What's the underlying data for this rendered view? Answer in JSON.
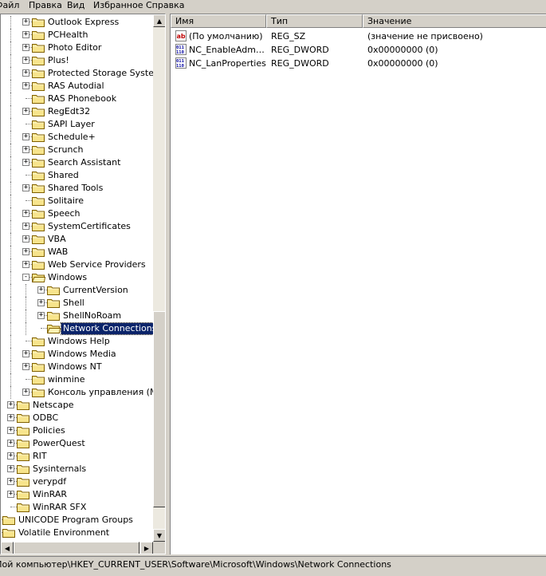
{
  "menu": {
    "items": [
      "Файл",
      "Правка",
      "Вид",
      "Избранное",
      "Справка"
    ]
  },
  "tree": {
    "items": [
      {
        "label": "Outlook Express",
        "expander": "+",
        "level": 2
      },
      {
        "label": "PCHealth",
        "expander": "+",
        "level": 2
      },
      {
        "label": "Photo Editor",
        "expander": "+",
        "level": 2
      },
      {
        "label": "Plus!",
        "expander": "+",
        "level": 2
      },
      {
        "label": "Protected Storage System Provider",
        "expander": "+",
        "level": 2
      },
      {
        "label": "RAS Autodial",
        "expander": "+",
        "level": 2
      },
      {
        "label": "RAS Phonebook",
        "expander": "",
        "level": 2
      },
      {
        "label": "RegEdt32",
        "expander": "+",
        "level": 2
      },
      {
        "label": "SAPI Layer",
        "expander": "",
        "level": 2
      },
      {
        "label": "Schedule+",
        "expander": "+",
        "level": 2
      },
      {
        "label": "Scrunch",
        "expander": "+",
        "level": 2
      },
      {
        "label": "Search Assistant",
        "expander": "+",
        "level": 2
      },
      {
        "label": "Shared",
        "expander": "",
        "level": 2
      },
      {
        "label": "Shared Tools",
        "expander": "+",
        "level": 2
      },
      {
        "label": "Solitaire",
        "expander": "",
        "level": 2
      },
      {
        "label": "Speech",
        "expander": "+",
        "level": 2
      },
      {
        "label": "SystemCertificates",
        "expander": "+",
        "level": 2
      },
      {
        "label": "VBA",
        "expander": "+",
        "level": 2
      },
      {
        "label": "WAB",
        "expander": "+",
        "level": 2
      },
      {
        "label": "Web Service Providers",
        "expander": "+",
        "level": 2
      },
      {
        "label": "Windows",
        "expander": "−",
        "level": 2
      },
      {
        "label": "CurrentVersion",
        "expander": "+",
        "level": 3
      },
      {
        "label": "Shell",
        "expander": "+",
        "level": 3
      },
      {
        "label": "ShellNoRoam",
        "expander": "+",
        "level": 3
      },
      {
        "label": "Network Connections",
        "expander": "",
        "level": 3,
        "selected": true
      },
      {
        "label": "Windows Help",
        "expander": "",
        "level": 2
      },
      {
        "label": "Windows Media",
        "expander": "+",
        "level": 2
      },
      {
        "label": "Windows NT",
        "expander": "+",
        "level": 2
      },
      {
        "label": "winmine",
        "expander": "",
        "level": 2
      },
      {
        "label": "Консоль управления (MMC)",
        "expander": "+",
        "level": 2
      },
      {
        "label": "Netscape",
        "expander": "+",
        "level": 1
      },
      {
        "label": "ODBC",
        "expander": "+",
        "level": 1
      },
      {
        "label": "Policies",
        "expander": "+",
        "level": 1
      },
      {
        "label": "PowerQuest",
        "expander": "+",
        "level": 1
      },
      {
        "label": "RIT",
        "expander": "+",
        "level": 1
      },
      {
        "label": "Sysinternals",
        "expander": "+",
        "level": 1
      },
      {
        "label": "verypdf",
        "expander": "+",
        "level": 1
      },
      {
        "label": "WinRAR",
        "expander": "+",
        "level": 1
      },
      {
        "label": "WinRAR SFX",
        "expander": "",
        "level": 1
      },
      {
        "label": "UNICODE Program Groups",
        "expander": "",
        "level": 0
      },
      {
        "label": "Volatile Environment",
        "expander": "",
        "level": 0
      }
    ]
  },
  "list": {
    "columns": [
      "Имя",
      "Тип",
      "Значение"
    ],
    "rows": [
      {
        "name": "(По умолчанию)",
        "type": "REG_SZ",
        "value": "(значение не присвоено)",
        "icon": "string-value-icon"
      },
      {
        "name": "NC_EnableAdminProhibits",
        "type": "REG_DWORD",
        "value": "0x00000000 (0)",
        "icon": "binary-value-icon"
      },
      {
        "name": "NC_LanProperties",
        "type": "REG_DWORD",
        "value": "0x00000000 (0)",
        "icon": "binary-value-icon"
      }
    ]
  },
  "status": {
    "path": "Мой компьютер\\HKEY_CURRENT_USER\\Software\\Microsoft\\Windows\\Network Connections"
  },
  "colors": {
    "selection": "#0a246a",
    "folder": "#f7e48c",
    "chrome": "#d4d0c8"
  }
}
